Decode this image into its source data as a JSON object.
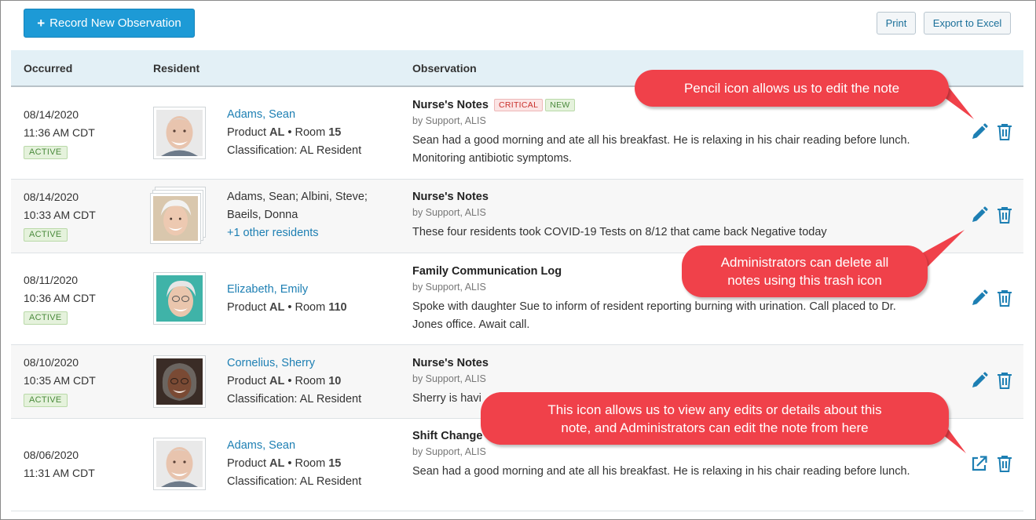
{
  "toolbar": {
    "record_label": "Record New Observation",
    "print_label": "Print",
    "export_label": "Export to Excel"
  },
  "table": {
    "headers": {
      "occurred": "Occurred",
      "resident": "Resident",
      "observation": "Observation"
    },
    "rows": [
      {
        "date": "08/14/2020",
        "time": "11:36 AM CDT",
        "status": "ACTIVE",
        "resident_name": "Adams, Sean",
        "product_prefix": "Product",
        "product": "AL",
        "room_prefix": "• Room",
        "room": "15",
        "classification": "Classification: AL Resident",
        "title": "Nurse's Notes",
        "tag_critical": "CRITICAL",
        "tag_new": "NEW",
        "by": "by Support, ALIS",
        "text": "Sean had a good morning and ate all his breakfast. He is relaxing in his chair reading before lunch. Monitoring antibiotic symptoms."
      },
      {
        "date": "08/14/2020",
        "time": "10:33 AM CDT",
        "status": "ACTIVE",
        "residents_line1": "Adams, Sean; Albini, Steve;",
        "residents_line2": "Baeils, Donna",
        "others": "+1 other residents",
        "title": "Nurse's Notes",
        "by": "by Support, ALIS",
        "text": "These four residents took COVID-19 Tests on 8/12 that came back Negative today"
      },
      {
        "date": "08/11/2020",
        "time": "10:36 AM CDT",
        "status": "ACTIVE",
        "resident_name": "Elizabeth, Emily",
        "product_prefix": "Product",
        "product": "AL",
        "room_prefix": "• Room",
        "room": "110",
        "title": "Family Communication Log",
        "by": "by Support, ALIS",
        "text": "Spoke with daughter Sue to inform of resident reporting burning with urination. Call placed to Dr. Jones office. Await call."
      },
      {
        "date": "08/10/2020",
        "time": "10:35 AM CDT",
        "status": "ACTIVE",
        "resident_name": "Cornelius, Sherry",
        "product_prefix": "Product",
        "product": "AL",
        "room_prefix": "• Room",
        "room": "10",
        "classification": "Classification: AL Resident",
        "title": "Nurse's Notes",
        "by": "by Support, ALIS",
        "text": "Sherry is havi"
      },
      {
        "date": "08/06/2020",
        "time": "11:31 AM CDT",
        "resident_name": "Adams, Sean",
        "product_prefix": "Product",
        "product": "AL",
        "room_prefix": "• Room",
        "room": "15",
        "classification": "Classification: AL Resident",
        "title": "Shift Change",
        "by": "by Support, ALIS",
        "text": "Sean had a good morning and ate all his breakfast. He is relaxing in his chair reading before lunch."
      }
    ]
  },
  "callouts": {
    "pencil": "Pencil icon allows us to edit the note",
    "trash_line1": "Administrators can delete all",
    "trash_line2": "notes using this trash icon",
    "view_line1": "This icon allows us to view any edits or details about this",
    "view_line2": "note, and Administrators can edit the note from here"
  },
  "icons": {
    "edit": "pencil-icon",
    "delete": "trash-icon",
    "details": "external-link-icon"
  },
  "colors": {
    "primary": "#1d9ad6",
    "link": "#1d7fb3",
    "callout": "#f0414a",
    "header_bg": "#e3f0f6"
  }
}
